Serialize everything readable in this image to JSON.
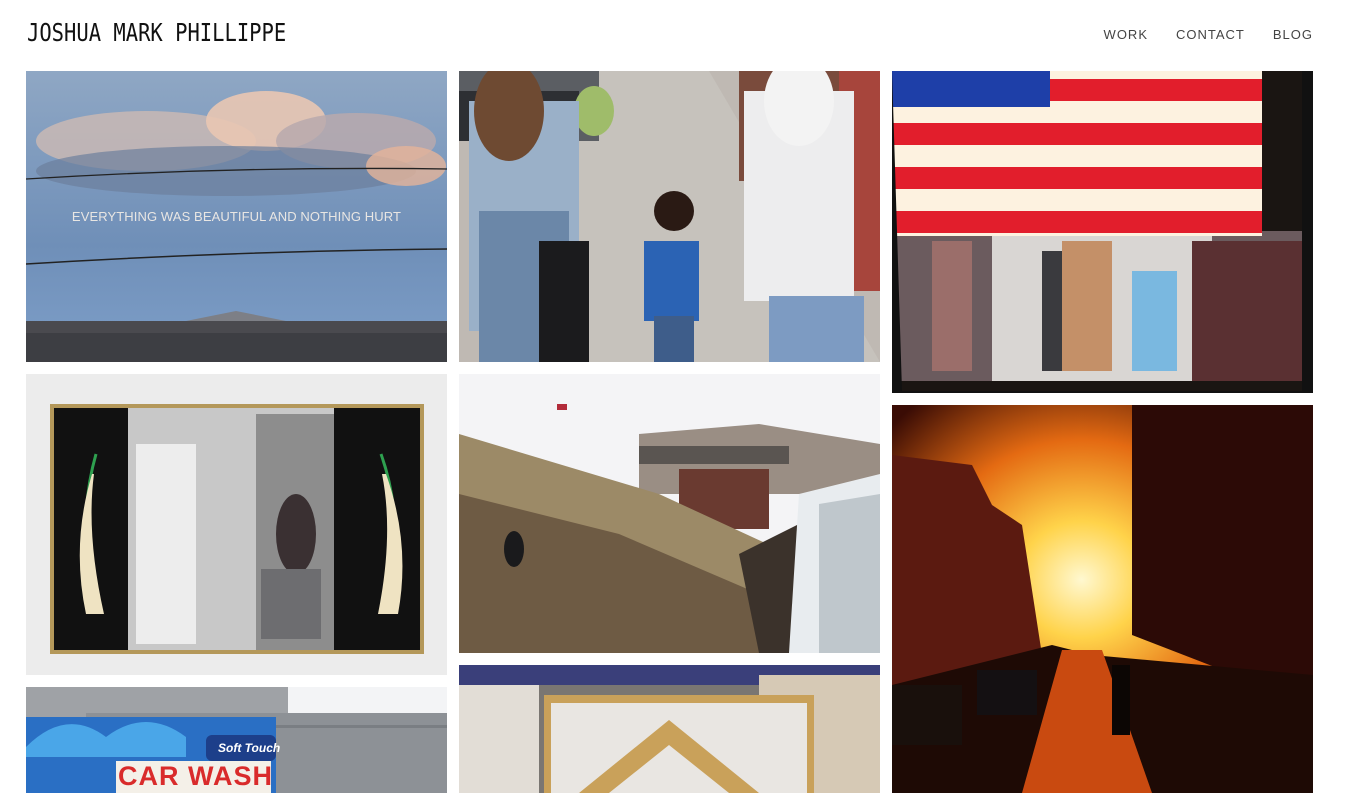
{
  "site": {
    "title": "JOSHUA MARK PHILLIPPE"
  },
  "nav": {
    "items": [
      "WORK",
      "CONTACT",
      "BLOG"
    ]
  },
  "gallery": {
    "clouds_caption": "EVERYTHING WAS BEAUTIFUL AND NOTHING HURT",
    "sign_text_1": "Soft Touch",
    "sign_text_2": "CAR WASH"
  }
}
